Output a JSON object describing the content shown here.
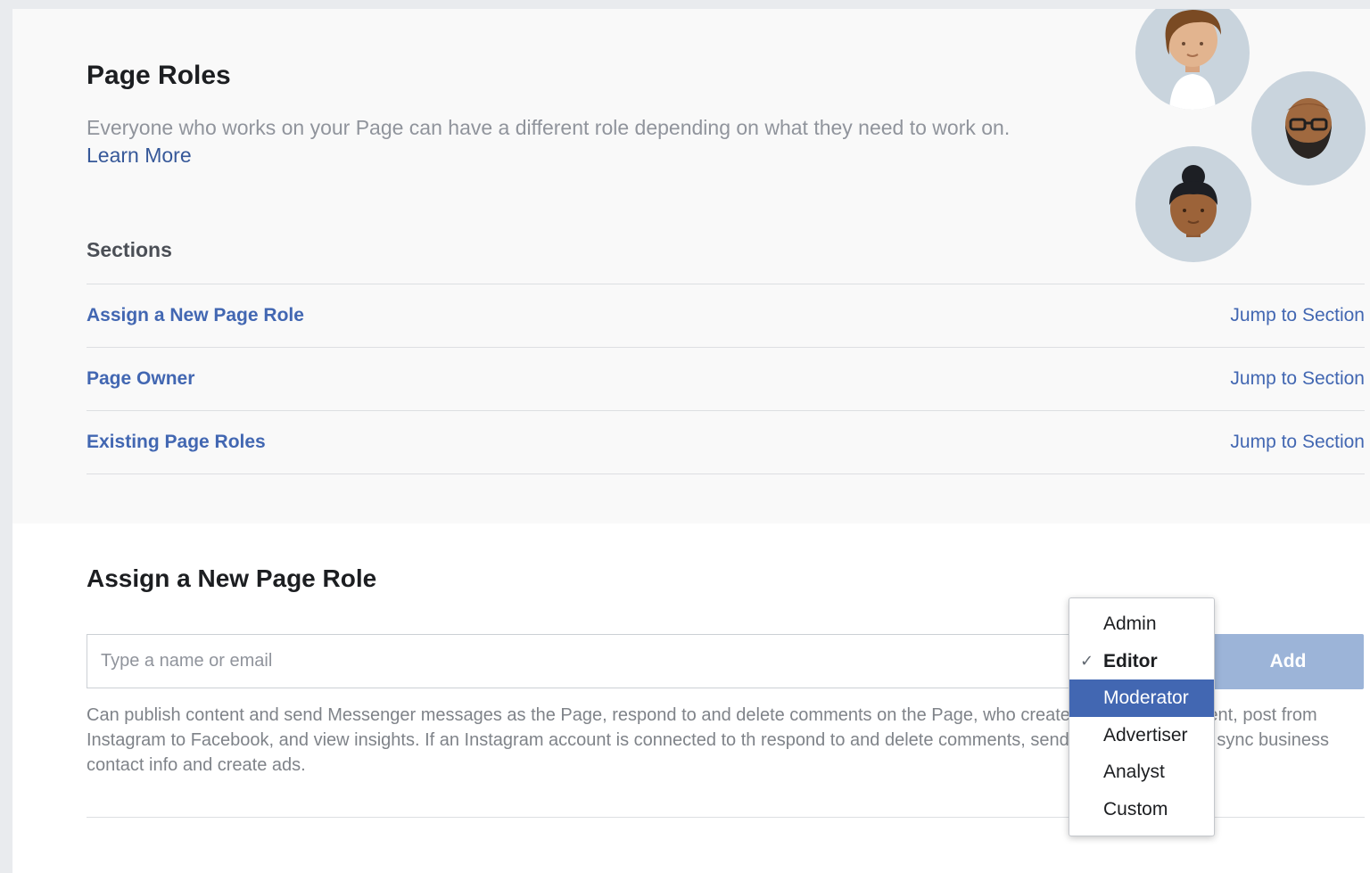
{
  "header": {
    "title": "Page Roles",
    "description": "Everyone who works on your Page can have a different role depending on what they need to work on.",
    "learn_more": "Learn More"
  },
  "sections": {
    "heading": "Sections",
    "items": [
      {
        "label": "Assign a New Page Role",
        "jump": "Jump to Section"
      },
      {
        "label": "Page Owner",
        "jump": "Jump to Section"
      },
      {
        "label": "Existing Page Roles",
        "jump": "Jump to Section"
      }
    ]
  },
  "assign": {
    "title": "Assign a New Page Role",
    "input_placeholder": "Type a name or email",
    "add_label": "Add",
    "role_description": "Can publish content and send Messenger messages as the Page, respond to and delete comments on the Page, who created a post or comment, post from Instagram to Facebook, and view insights. If an Instagram account is connected to th respond to and delete comments, send Direct messages, sync business contact info and create ads."
  },
  "dropdown": {
    "options": [
      "Admin",
      "Editor",
      "Moderator",
      "Advertiser",
      "Analyst",
      "Custom"
    ],
    "selected": "Editor",
    "highlighted": "Moderator",
    "check_glyph": "✓"
  },
  "colors": {
    "link": "#4267b2",
    "add_button": "#9cb4d8",
    "highlight": "#4267b2"
  }
}
